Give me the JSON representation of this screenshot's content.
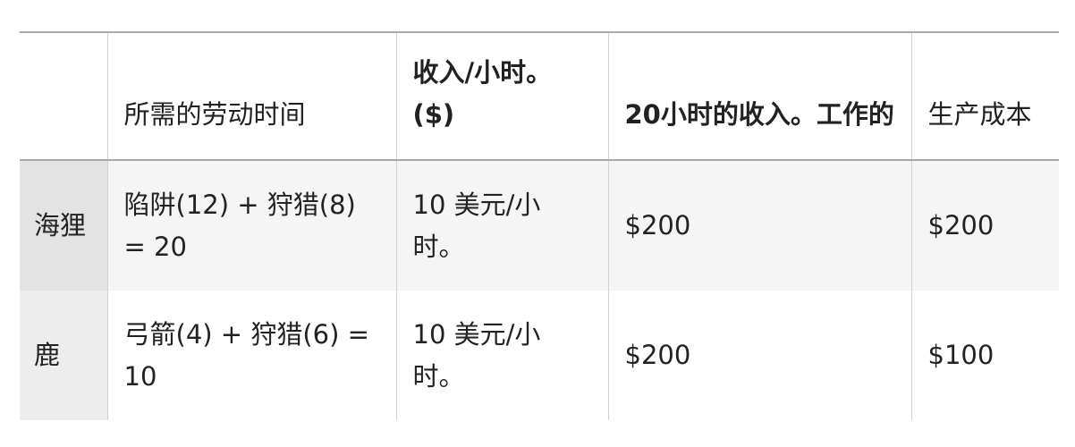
{
  "table": {
    "headers": [
      "",
      "所需的劳动时间",
      "收入/小时。($)",
      "20小时的收入。工作的",
      "生产成本"
    ],
    "rows": [
      {
        "name": "海狸",
        "labor": "陷阱(12) + 狩猎(8) = 20",
        "rate": "10 美元/小时。",
        "income": "$200",
        "cost": "$200"
      },
      {
        "name": "鹿",
        "labor": "弓箭(4) + 狩猎(6) = 10",
        "rate": "10 美元/小时。",
        "income": "$200",
        "cost": "$100"
      }
    ]
  }
}
